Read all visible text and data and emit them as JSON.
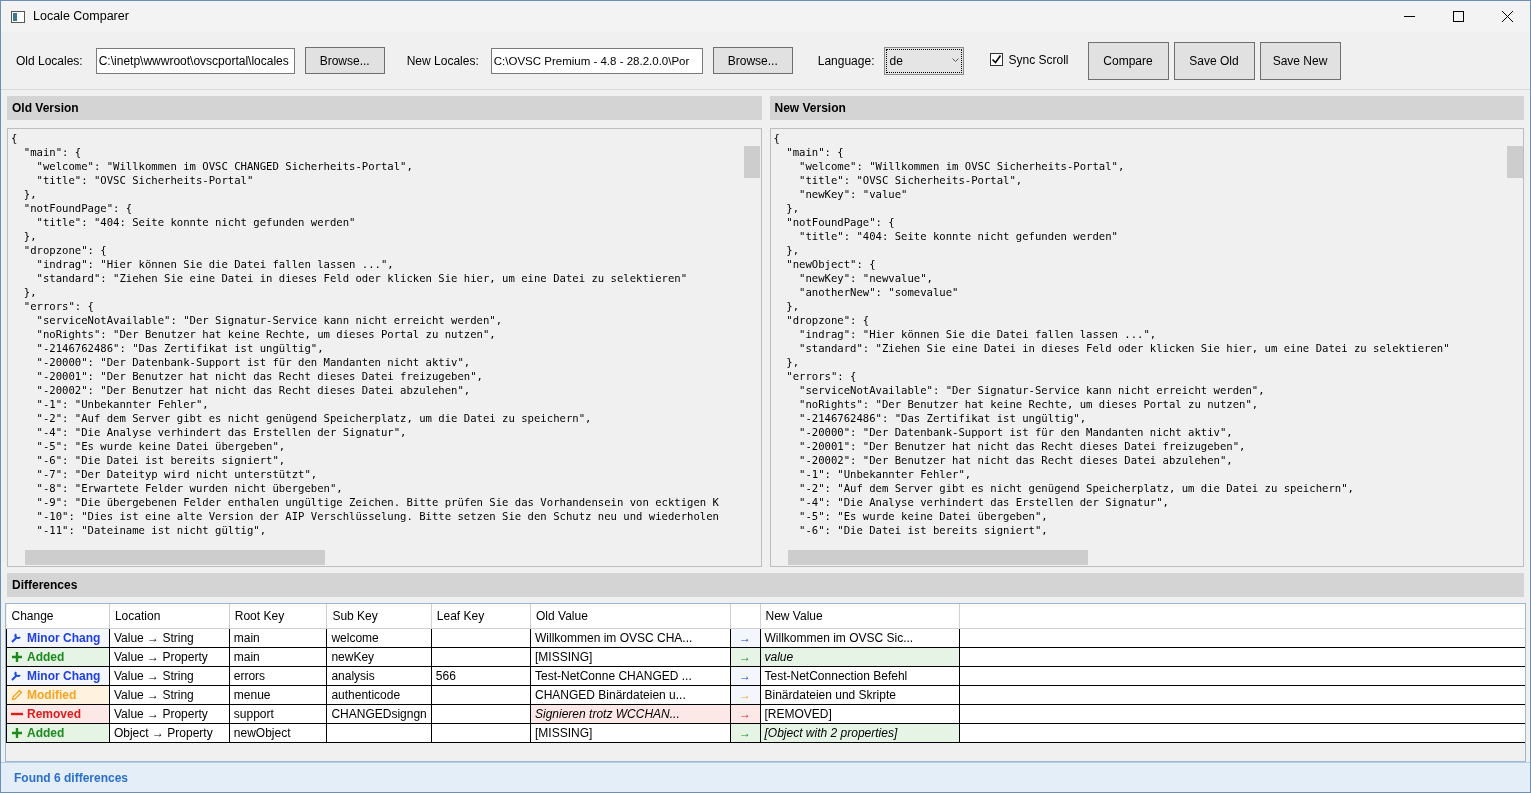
{
  "window": {
    "title": "Locale Comparer"
  },
  "toolbar": {
    "old_label": "Old Locales:",
    "old_path": "C:\\inetp\\wwwroot\\ovscportal\\locales",
    "old_browse": "Browse...",
    "new_label": "New Locales:",
    "new_path": "C:\\OVSC Premium - 4.8 - 28.2.0.0\\Por",
    "new_browse": "Browse...",
    "language_label": "Language:",
    "language": "de",
    "sync_scroll": {
      "label": "Sync Scroll",
      "checked": true
    },
    "buttons": [
      "Compare",
      "Save Old",
      "Save New"
    ]
  },
  "old_panel": {
    "title": "Old Version",
    "lines": [
      "{",
      "  \"main\": {",
      "    \"welcome\": \"Willkommen im OVSC CHANGED Sicherheits-Portal\",",
      "    \"title\": \"OVSC Sicherheits-Portal\"",
      "  },",
      "  \"notFoundPage\": {",
      "    \"title\": \"404: Seite konnte nicht gefunden werden\"",
      "  },",
      "  \"dropzone\": {",
      "    \"indrag\": \"Hier können Sie die Datei fallen lassen ...\",",
      "    \"standard\": \"Ziehen Sie eine Datei in dieses Feld oder klicken Sie hier, um eine Datei zu selektieren\"",
      "  },",
      "  \"errors\": {",
      "    \"serviceNotAvailable\": \"Der Signatur-Service kann nicht erreicht werden\",",
      "    \"noRights\": \"Der Benutzer hat keine Rechte, um dieses Portal zu nutzen\",",
      "    \"-2146762486\": \"Das Zertifikat ist ungültig\",",
      "    \"-20000\": \"Der Datenbank-Support ist für den Mandanten nicht aktiv\",",
      "    \"-20001\": \"Der Benutzer hat nicht das Recht dieses Datei freizugeben\",",
      "    \"-20002\": \"Der Benutzer hat nicht das Recht dieses Datei abzulehen\",",
      "    \"-1\": \"Unbekannter Fehler\",",
      "    \"-2\": \"Auf dem Server gibt es nicht genügend Speicherplatz, um die Datei zu speichern\",",
      "    \"-4\": \"Die Analyse verhindert das Erstellen der Signatur\",",
      "    \"-5\": \"Es wurde keine Datei übergeben\",",
      "    \"-6\": \"Die Datei ist bereits signiert\",",
      "    \"-7\": \"Der Dateityp wird nicht unterstützt\",",
      "    \"-8\": \"Erwartete Felder wurden nicht übergeben\",",
      "    \"-9\": \"Die übergebenen Felder enthalen ungültige Zeichen. Bitte prüfen Sie das Vorhandensein von ecktigen K",
      "    \"-10\": \"Dies ist eine alte Version der AIP Verschlüsselung. Bitte setzen Sie den Schutz neu und wiederholen",
      "    \"-11\": \"Dateiname ist nicht gültig\","
    ]
  },
  "new_panel": {
    "title": "New Version",
    "lines": [
      "{",
      "  \"main\": {",
      "    \"welcome\": \"Willkommen im OVSC Sicherheits-Portal\",",
      "    \"title\": \"OVSC Sicherheits-Portal\",",
      "    \"newKey\": \"value\"",
      "  },",
      "  \"notFoundPage\": {",
      "    \"title\": \"404: Seite konnte nicht gefunden werden\"",
      "  },",
      "  \"newObject\": {",
      "    \"newKey\": \"newvalue\",",
      "    \"anotherNew\": \"somevalue\"",
      "  },",
      "  \"dropzone\": {",
      "    \"indrag\": \"Hier können Sie die Datei fallen lassen ...\",",
      "    \"standard\": \"Ziehen Sie eine Datei in dieses Feld oder klicken Sie hier, um eine Datei zu selektieren\"",
      "  },",
      "  \"errors\": {",
      "    \"serviceNotAvailable\": \"Der Signatur-Service kann nicht erreicht werden\",",
      "    \"noRights\": \"Der Benutzer hat keine Rechte, um dieses Portal zu nutzen\",",
      "    \"-2146762486\": \"Das Zertifikat ist ungültig\",",
      "    \"-20000\": \"Der Datenbank-Support ist für den Mandanten nicht aktiv\",",
      "    \"-20001\": \"Der Benutzer hat nicht das Recht dieses Datei freizugeben\",",
      "    \"-20002\": \"Der Benutzer hat nicht das Recht dieses Datei abzulehen\",",
      "    \"-1\": \"Unbekannter Fehler\",",
      "    \"-2\": \"Auf dem Server gibt es nicht genügend Speicherplatz, um die Datei zu speichern\",",
      "    \"-4\": \"Die Analyse verhindert das Erstellen der Signatur\",",
      "    \"-5\": \"Es wurde keine Datei übergeben\",",
      "    \"-6\": \"Die Datei ist bereits signiert\","
    ]
  },
  "differences": {
    "title": "Differences",
    "columns": [
      "Change",
      "Location",
      "Root Key",
      "Sub Key",
      "Leaf Key",
      "Old Value",
      "New Value"
    ],
    "rows": [
      {
        "kind": "minor",
        "change": "Minor Chang",
        "location": "Value → String",
        "root_key": "main",
        "sub_key": "welcome",
        "old_value": "Willkommen im OVSC CHA...",
        "arrow": "→",
        "new_value": "Willkommen im OVSC Sic..."
      },
      {
        "kind": "added",
        "change": "Added",
        "location": "Value → Property",
        "root_key": "main",
        "sub_key": "newKey",
        "old_value": "[MISSING]",
        "arrow": "→",
        "new_value": "value"
      },
      {
        "kind": "minor",
        "change": "Minor Chang",
        "location": "Value → String",
        "root_key": "errors",
        "sub_key": "analysis",
        "leaf_key": "566",
        "old_value": "Test-NetConne CHANGED ...",
        "arrow": "→",
        "new_value": "Test-NetConnection Befehl"
      },
      {
        "kind": "modified",
        "change": "Modified",
        "location": "Value → String",
        "root_key": "menue",
        "sub_key": "authenticode",
        "old_value": "CHANGED Binärdateien u...",
        "arrow": "→",
        "new_value": "Binärdateien und Skripte"
      },
      {
        "kind": "removed",
        "change": "Removed",
        "location": "Value → Property",
        "root_key": "support",
        "sub_key": "CHANGEDsigngn",
        "old_value": "Signieren trotz WCCHAN...",
        "arrow": "→",
        "new_value": "[REMOVED]"
      },
      {
        "kind": "added",
        "change": "Added",
        "location": "Object → Property",
        "root_key": "newObject",
        "old_value": "[MISSING]",
        "arrow": "→",
        "new_value": "[Object with 2 properties]"
      }
    ]
  },
  "status_bar": "Found 6 differences"
}
